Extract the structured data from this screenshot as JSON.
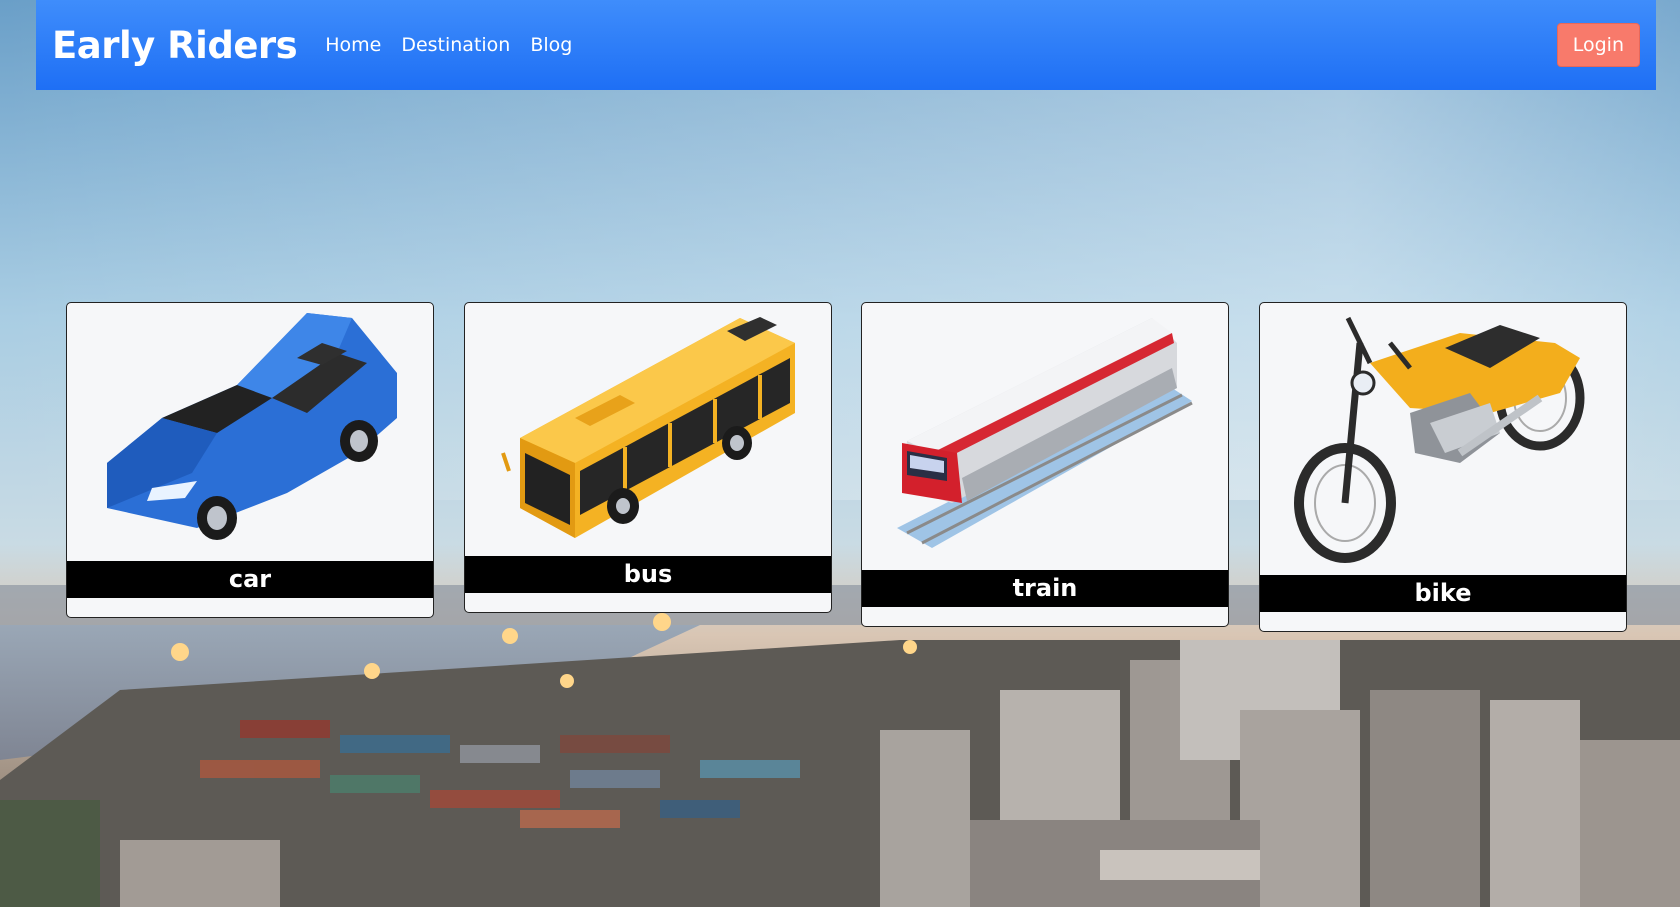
{
  "navbar": {
    "brand": "Early Riders",
    "links": [
      "Home",
      "Destination",
      "Blog"
    ],
    "login_label": "Login"
  },
  "vehicles": [
    {
      "label": "car",
      "icon": "car-icon"
    },
    {
      "label": "bus",
      "icon": "bus-icon"
    },
    {
      "label": "train",
      "icon": "train-icon"
    },
    {
      "label": "bike",
      "icon": "motorbike-icon"
    }
  ],
  "colors": {
    "navbar": "#1e6ff5",
    "login_button": "#f87a6b",
    "card_background": "#f6f7f9",
    "label_bar": "#000000"
  }
}
